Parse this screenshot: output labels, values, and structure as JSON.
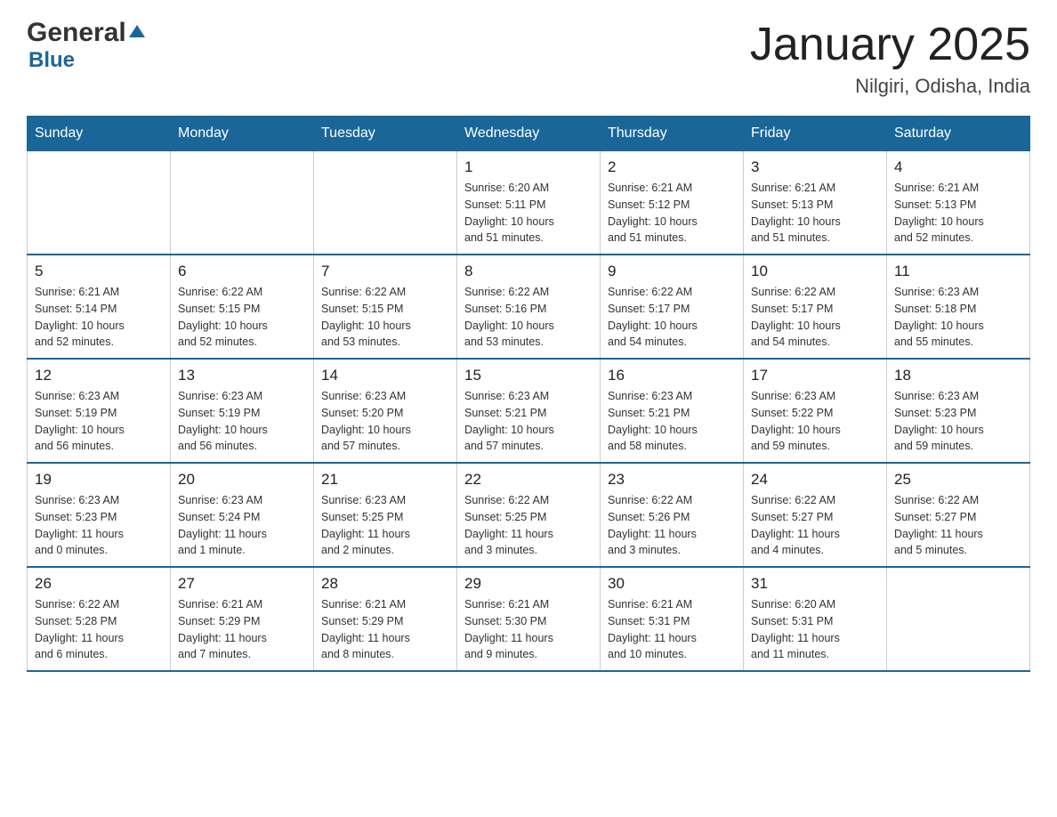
{
  "logo": {
    "general": "General",
    "blue": "Blue"
  },
  "title": "January 2025",
  "subtitle": "Nilgiri, Odisha, India",
  "days": [
    "Sunday",
    "Monday",
    "Tuesday",
    "Wednesday",
    "Thursday",
    "Friday",
    "Saturday"
  ],
  "weeks": [
    [
      {
        "day": "",
        "info": ""
      },
      {
        "day": "",
        "info": ""
      },
      {
        "day": "",
        "info": ""
      },
      {
        "day": "1",
        "info": "Sunrise: 6:20 AM\nSunset: 5:11 PM\nDaylight: 10 hours\nand 51 minutes."
      },
      {
        "day": "2",
        "info": "Sunrise: 6:21 AM\nSunset: 5:12 PM\nDaylight: 10 hours\nand 51 minutes."
      },
      {
        "day": "3",
        "info": "Sunrise: 6:21 AM\nSunset: 5:13 PM\nDaylight: 10 hours\nand 51 minutes."
      },
      {
        "day": "4",
        "info": "Sunrise: 6:21 AM\nSunset: 5:13 PM\nDaylight: 10 hours\nand 52 minutes."
      }
    ],
    [
      {
        "day": "5",
        "info": "Sunrise: 6:21 AM\nSunset: 5:14 PM\nDaylight: 10 hours\nand 52 minutes."
      },
      {
        "day": "6",
        "info": "Sunrise: 6:22 AM\nSunset: 5:15 PM\nDaylight: 10 hours\nand 52 minutes."
      },
      {
        "day": "7",
        "info": "Sunrise: 6:22 AM\nSunset: 5:15 PM\nDaylight: 10 hours\nand 53 minutes."
      },
      {
        "day": "8",
        "info": "Sunrise: 6:22 AM\nSunset: 5:16 PM\nDaylight: 10 hours\nand 53 minutes."
      },
      {
        "day": "9",
        "info": "Sunrise: 6:22 AM\nSunset: 5:17 PM\nDaylight: 10 hours\nand 54 minutes."
      },
      {
        "day": "10",
        "info": "Sunrise: 6:22 AM\nSunset: 5:17 PM\nDaylight: 10 hours\nand 54 minutes."
      },
      {
        "day": "11",
        "info": "Sunrise: 6:23 AM\nSunset: 5:18 PM\nDaylight: 10 hours\nand 55 minutes."
      }
    ],
    [
      {
        "day": "12",
        "info": "Sunrise: 6:23 AM\nSunset: 5:19 PM\nDaylight: 10 hours\nand 56 minutes."
      },
      {
        "day": "13",
        "info": "Sunrise: 6:23 AM\nSunset: 5:19 PM\nDaylight: 10 hours\nand 56 minutes."
      },
      {
        "day": "14",
        "info": "Sunrise: 6:23 AM\nSunset: 5:20 PM\nDaylight: 10 hours\nand 57 minutes."
      },
      {
        "day": "15",
        "info": "Sunrise: 6:23 AM\nSunset: 5:21 PM\nDaylight: 10 hours\nand 57 minutes."
      },
      {
        "day": "16",
        "info": "Sunrise: 6:23 AM\nSunset: 5:21 PM\nDaylight: 10 hours\nand 58 minutes."
      },
      {
        "day": "17",
        "info": "Sunrise: 6:23 AM\nSunset: 5:22 PM\nDaylight: 10 hours\nand 59 minutes."
      },
      {
        "day": "18",
        "info": "Sunrise: 6:23 AM\nSunset: 5:23 PM\nDaylight: 10 hours\nand 59 minutes."
      }
    ],
    [
      {
        "day": "19",
        "info": "Sunrise: 6:23 AM\nSunset: 5:23 PM\nDaylight: 11 hours\nand 0 minutes."
      },
      {
        "day": "20",
        "info": "Sunrise: 6:23 AM\nSunset: 5:24 PM\nDaylight: 11 hours\nand 1 minute."
      },
      {
        "day": "21",
        "info": "Sunrise: 6:23 AM\nSunset: 5:25 PM\nDaylight: 11 hours\nand 2 minutes."
      },
      {
        "day": "22",
        "info": "Sunrise: 6:22 AM\nSunset: 5:25 PM\nDaylight: 11 hours\nand 3 minutes."
      },
      {
        "day": "23",
        "info": "Sunrise: 6:22 AM\nSunset: 5:26 PM\nDaylight: 11 hours\nand 3 minutes."
      },
      {
        "day": "24",
        "info": "Sunrise: 6:22 AM\nSunset: 5:27 PM\nDaylight: 11 hours\nand 4 minutes."
      },
      {
        "day": "25",
        "info": "Sunrise: 6:22 AM\nSunset: 5:27 PM\nDaylight: 11 hours\nand 5 minutes."
      }
    ],
    [
      {
        "day": "26",
        "info": "Sunrise: 6:22 AM\nSunset: 5:28 PM\nDaylight: 11 hours\nand 6 minutes."
      },
      {
        "day": "27",
        "info": "Sunrise: 6:21 AM\nSunset: 5:29 PM\nDaylight: 11 hours\nand 7 minutes."
      },
      {
        "day": "28",
        "info": "Sunrise: 6:21 AM\nSunset: 5:29 PM\nDaylight: 11 hours\nand 8 minutes."
      },
      {
        "day": "29",
        "info": "Sunrise: 6:21 AM\nSunset: 5:30 PM\nDaylight: 11 hours\nand 9 minutes."
      },
      {
        "day": "30",
        "info": "Sunrise: 6:21 AM\nSunset: 5:31 PM\nDaylight: 11 hours\nand 10 minutes."
      },
      {
        "day": "31",
        "info": "Sunrise: 6:20 AM\nSunset: 5:31 PM\nDaylight: 11 hours\nand 11 minutes."
      },
      {
        "day": "",
        "info": ""
      }
    ]
  ]
}
